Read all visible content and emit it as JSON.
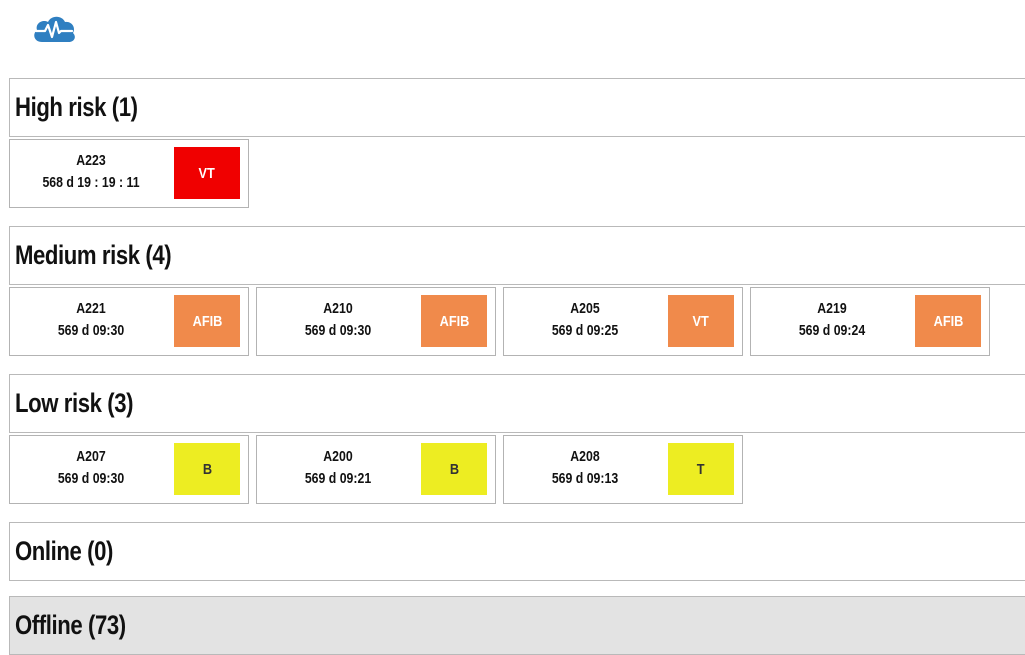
{
  "colors": {
    "high": "#f00000",
    "medium": "#f08a4b",
    "low": "#eded22",
    "logo": "#2f7fc1",
    "offline_bg": "#e3e3e3"
  },
  "logo": {
    "icon": "cloud-heartbeat-icon"
  },
  "high": {
    "title": "High risk (1)",
    "cards": [
      {
        "id": "A223",
        "time": "568 d 19 : 19 : 11",
        "badge": "VT"
      }
    ]
  },
  "medium": {
    "title": "Medium risk (4)",
    "cards": [
      {
        "id": "A221",
        "time": "569 d 09:30",
        "badge": "AFIB"
      },
      {
        "id": "A210",
        "time": "569 d 09:30",
        "badge": "AFIB"
      },
      {
        "id": "A205",
        "time": "569 d 09:25",
        "badge": "VT"
      },
      {
        "id": "A219",
        "time": "569 d 09:24",
        "badge": "AFIB"
      }
    ]
  },
  "low": {
    "title": "Low risk (3)",
    "cards": [
      {
        "id": "A207",
        "time": "569 d 09:30",
        "badge": "B"
      },
      {
        "id": "A200",
        "time": "569 d 09:21",
        "badge": "B"
      },
      {
        "id": "A208",
        "time": "569 d 09:13",
        "badge": "T"
      }
    ]
  },
  "online": {
    "title": "Online (0)"
  },
  "offline": {
    "title": "Offline (73)"
  }
}
